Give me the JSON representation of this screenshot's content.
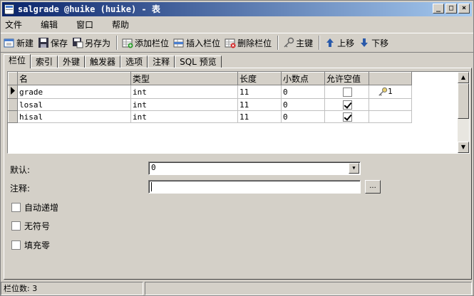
{
  "window": {
    "title": "salgrade @huike (huike) - 表",
    "buttons": [
      "_",
      "□",
      "×"
    ]
  },
  "menu": [
    "文件",
    "编辑",
    "窗口",
    "帮助"
  ],
  "toolbar": {
    "new": "新建",
    "save": "保存",
    "save_as": "另存为",
    "add_field": "添加栏位",
    "insert_field": "插入栏位",
    "delete_field": "删除栏位",
    "primary_key": "主键",
    "move_up": "上移",
    "move_down": "下移"
  },
  "tabs": [
    "栏位",
    "索引",
    "外键",
    "触发器",
    "选项",
    "注释",
    "SQL 预览"
  ],
  "grid": {
    "headers": [
      "名",
      "类型",
      "长度",
      "小数点",
      "允许空值",
      ""
    ],
    "rows": [
      {
        "name": "grade",
        "type": "int",
        "length": "11",
        "decimals": "0",
        "nullable": false,
        "key": "1"
      },
      {
        "name": "losal",
        "type": "int",
        "length": "11",
        "decimals": "0",
        "nullable": true,
        "key": ""
      },
      {
        "name": "hisal",
        "type": "int",
        "length": "11",
        "decimals": "0",
        "nullable": true,
        "key": ""
      }
    ]
  },
  "props": {
    "default_label": "默认:",
    "default_value": "0",
    "comment_label": "注释:",
    "comment_value": "",
    "ellipsis": "...",
    "auto_increment": "自动递增",
    "unsigned": "无符号",
    "zerofill": "填充零"
  },
  "status": {
    "field_count": "栏位数: 3"
  }
}
